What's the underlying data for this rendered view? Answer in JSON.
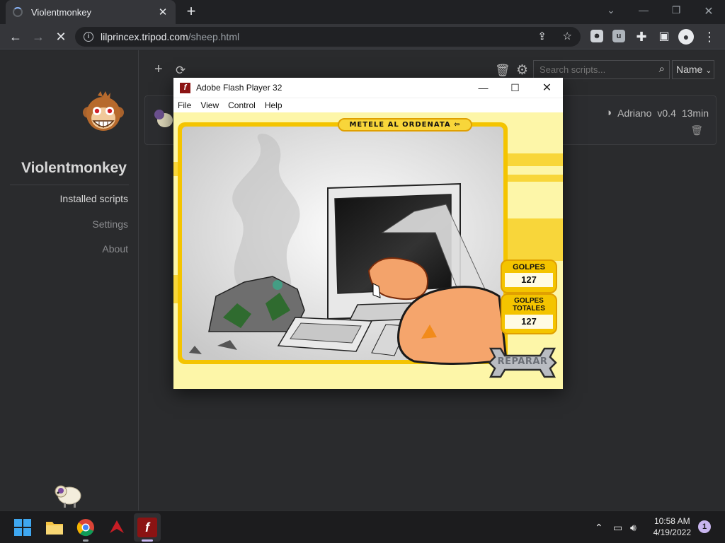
{
  "browser": {
    "tab_title": "Violentmonkey",
    "url_host": "lilprincex.tripod.com",
    "url_path": "/sheep.html"
  },
  "sidebar": {
    "brand": "Violentmonkey",
    "items": [
      {
        "label": "Installed scripts",
        "active": true
      },
      {
        "label": "Settings",
        "active": false
      },
      {
        "label": "About",
        "active": false
      }
    ]
  },
  "main": {
    "search_placeholder": "Search scripts...",
    "sort_label": "Name",
    "script": {
      "author": "Adriano",
      "version": "v0.4",
      "updated": "13min"
    }
  },
  "flash": {
    "title": "Adobe Flash Player 32",
    "menu": [
      "File",
      "View",
      "Control",
      "Help"
    ],
    "game": {
      "banner": "METELE AL ORDENATA",
      "golpes_label": "GOLPES",
      "golpes_value": "127",
      "totales_label": "GOLPES TOTALES",
      "totales_value": "127",
      "repair_label": "REPARAR"
    }
  },
  "taskbar": {
    "time": "10:58 AM",
    "date": "4/19/2022",
    "notification_count": "1"
  },
  "colors": {
    "accent": "#8ab4f8",
    "stage_yellow": "#fdf6a8",
    "game_gold": "#f4c400"
  }
}
